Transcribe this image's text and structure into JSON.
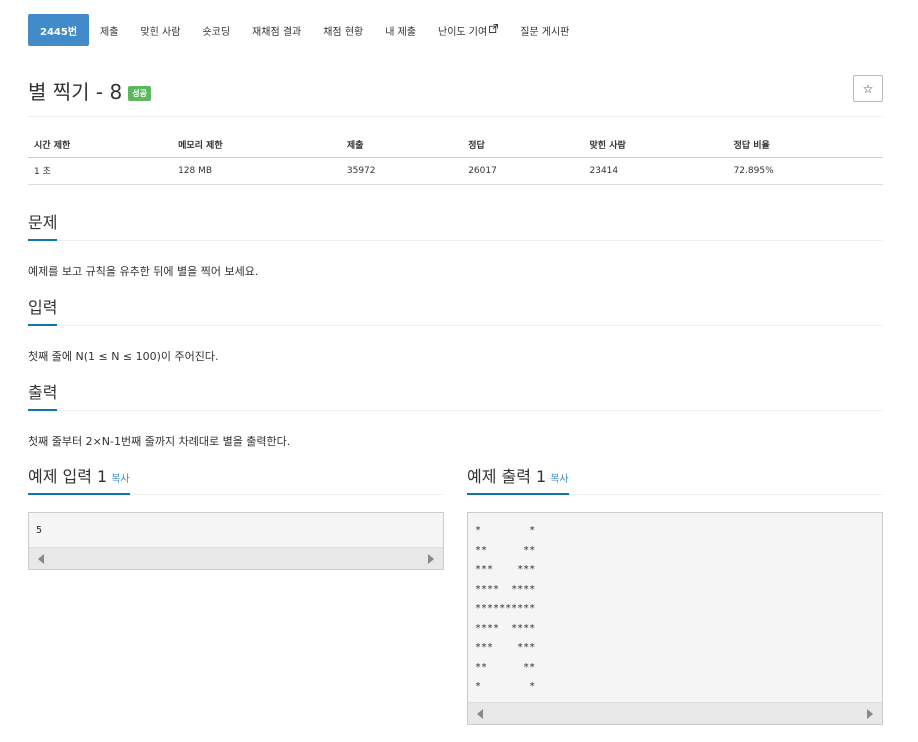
{
  "nav": {
    "tabs": [
      {
        "label": "2445번",
        "active": true
      },
      {
        "label": "제출"
      },
      {
        "label": "맞힌 사람"
      },
      {
        "label": "숏코딩"
      },
      {
        "label": "재채점 결과"
      },
      {
        "label": "채점 현황"
      },
      {
        "label": "내 제출"
      },
      {
        "label": "난이도 기여",
        "icon": "external-link-icon"
      },
      {
        "label": "질문 게시판"
      }
    ]
  },
  "problem": {
    "title": "별 찍기 - 8",
    "badge": "성공",
    "star_button": "☆"
  },
  "info_table": {
    "headers": [
      "시간 제한",
      "메모리 제한",
      "제출",
      "정답",
      "맞힌 사람",
      "정답 비율"
    ],
    "row": [
      "1 초",
      "128 MB",
      "35972",
      "26017",
      "23414",
      "72.895%"
    ]
  },
  "sections": {
    "description": {
      "title": "문제",
      "text": "예제를 보고 규칙을 유추한 뒤에 별을 찍어 보세요."
    },
    "input": {
      "title": "입력",
      "text": "첫째 줄에 N(1 ≤ N ≤ 100)이 주어진다."
    },
    "output": {
      "title": "출력",
      "text": "첫째 줄부터 2×N-1번째 줄까지 차례대로 별을 출력한다."
    }
  },
  "samples": {
    "input": {
      "title": "예제 입력 1",
      "copy": "복사",
      "content": "5"
    },
    "output": {
      "title": "예제 출력 1",
      "copy": "복사",
      "content": "*        *\n**      **\n***    ***\n****  ****\n**********\n****  ****\n***    ***\n**      **\n*        *"
    }
  },
  "colors": {
    "active_tab": "#428bca",
    "success_badge": "#5cb85c",
    "section_underline": "#0e76a8",
    "link": "#428bca"
  }
}
